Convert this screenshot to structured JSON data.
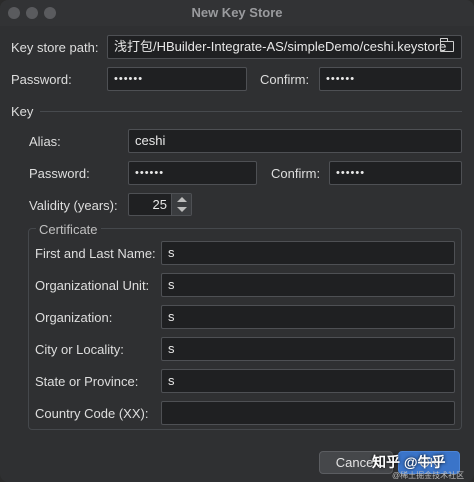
{
  "window": {
    "title": "New Key Store"
  },
  "keystore": {
    "path_label": "Key store path:",
    "path_value": "浅打包/HBuilder-Integrate-AS/simpleDemo/ceshi.keystore",
    "password_label": "Password:",
    "password_value": "••••••",
    "confirm_label": "Confirm:",
    "confirm_value": "••••••"
  },
  "key": {
    "section_label": "Key",
    "alias_label": "Alias:",
    "alias_value": "ceshi",
    "password_label": "Password:",
    "password_value": "••••••",
    "confirm_label": "Confirm:",
    "confirm_value": "••••••",
    "validity_label": "Validity (years):",
    "validity_value": "25"
  },
  "certificate": {
    "legend": "Certificate",
    "fields": [
      {
        "label": "First and Last Name:",
        "value": "s"
      },
      {
        "label": "Organizational Unit:",
        "value": "s"
      },
      {
        "label": "Organization:",
        "value": "s"
      },
      {
        "label": "City or Locality:",
        "value": "s"
      },
      {
        "label": "State or Province:",
        "value": "s"
      },
      {
        "label": "Country Code (XX):",
        "value": ""
      }
    ]
  },
  "buttons": {
    "cancel": "Cancel",
    "ok": "OK"
  },
  "watermark": {
    "text": "知乎 @牛乎",
    "sub": "@稀土掘金技术社区"
  },
  "icons": {
    "browse": "folder-icon"
  },
  "colors": {
    "ok_button": "#3a74c9",
    "background": "#2f3032"
  }
}
